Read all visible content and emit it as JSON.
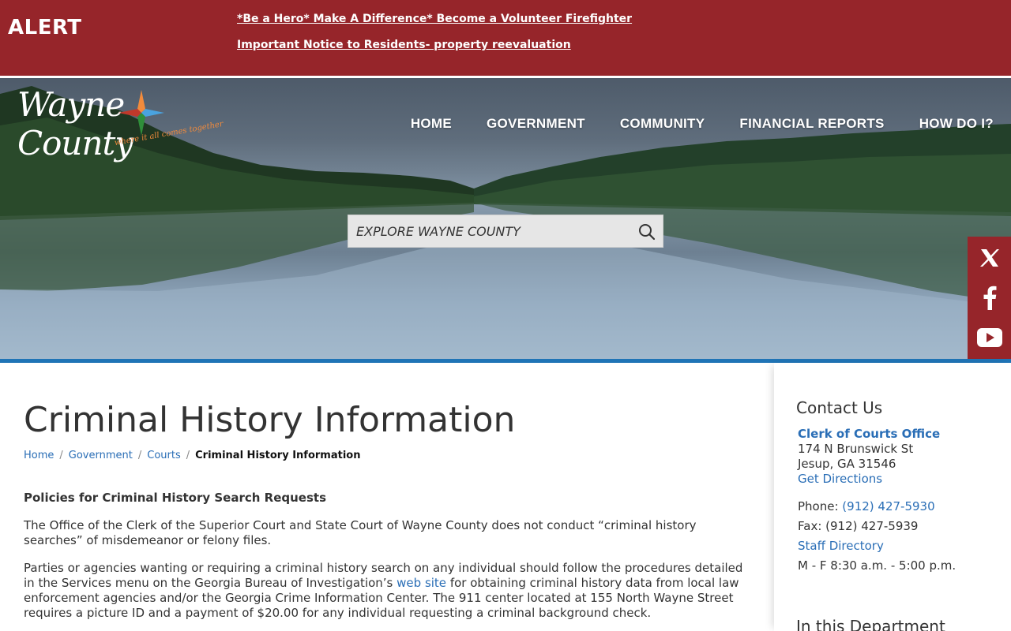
{
  "alert": {
    "title": "ALERT",
    "links": [
      "*Be a Hero* Make A Difference* Become a Volunteer Firefighter",
      "Important Notice to Residents- property reevaluation"
    ]
  },
  "logo": {
    "name": "Wayne County",
    "tagline": "where it all comes together"
  },
  "nav": [
    "HOME",
    "GOVERNMENT",
    "COMMUNITY",
    "FINANCIAL REPORTS",
    "HOW DO I?"
  ],
  "search": {
    "placeholder": "EXPLORE WAYNE COUNTY",
    "icon": "search-icon"
  },
  "social": [
    "x-icon",
    "facebook-icon",
    "youtube-icon"
  ],
  "colors": {
    "alert_bg": "#96252a",
    "accent_blue": "#1f74b6",
    "link": "#2a6eb6"
  },
  "page": {
    "title": "Criminal History Information",
    "breadcrumb": [
      "Home",
      "Government",
      "Courts",
      "Criminal History Information"
    ],
    "section_heading": "Policies for Criminal History Search Requests",
    "p1": "The Office of the Clerk of the Superior Court and State Court of Wayne County does not conduct “criminal history searches” of misdemeanor or felony files.",
    "p2_before": "Parties or agencies wanting or requiring a criminal history search on any individual should follow the procedures detailed in the Services menu on the Georgia Bureau of Investigation’s ",
    "p2_link": "web site",
    "p2_after": " for obtaining criminal history data from local law enforcement agencies and/or the Georgia Crime Information Center.  The 911 center located at 155 North Wayne Street requires a picture ID and a payment of $20.00 for any individual requesting a criminal background check."
  },
  "contact": {
    "title": "Contact Us",
    "office": "Clerk of Courts Office",
    "address1": "174 N Brunswick St",
    "address2": "Jesup, GA 31546",
    "directions": "Get Directions",
    "phone_label": "Phone: ",
    "phone": "(912) 427-5930",
    "fax": "Fax: (912) 427-5939",
    "staff": "Staff Directory",
    "hours": "M - F 8:30 a.m. - 5:00 p.m."
  },
  "department": {
    "title": "In this Department"
  }
}
